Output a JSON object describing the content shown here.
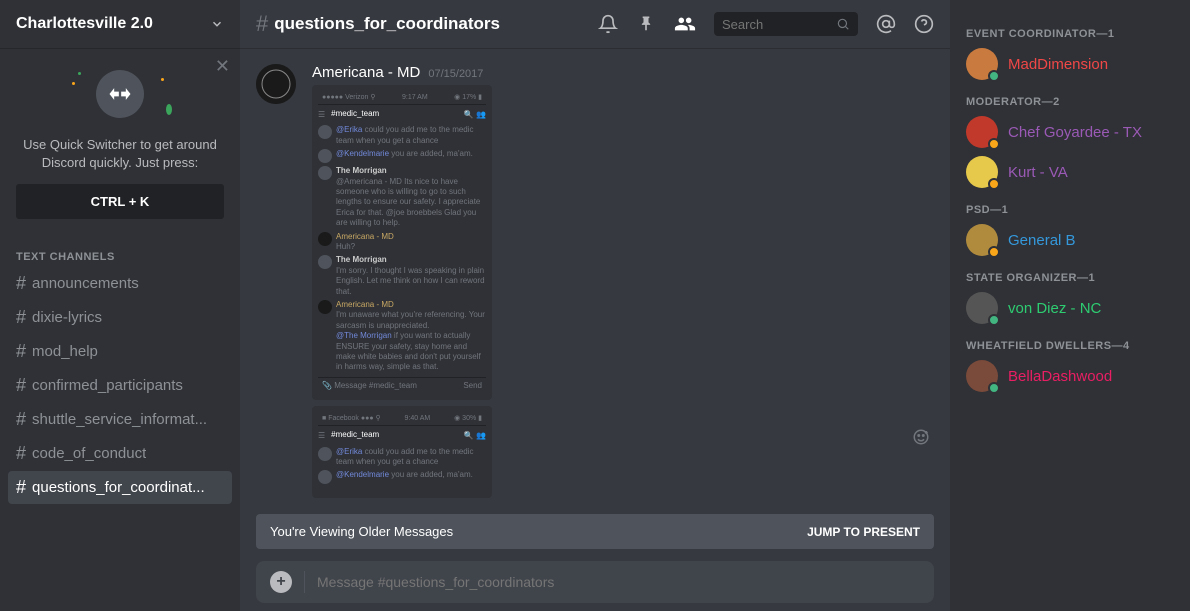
{
  "server": {
    "name": "Charlottesville 2.0"
  },
  "quick_switcher": {
    "text": "Use Quick Switcher to get around Discord quickly. Just press:",
    "button": "CTRL + K"
  },
  "channels": {
    "header": "TEXT CHANNELS",
    "items": [
      {
        "name": "announcements",
        "active": false
      },
      {
        "name": "dixie-lyrics",
        "active": false
      },
      {
        "name": "mod_help",
        "active": false
      },
      {
        "name": "confirmed_participants",
        "active": false
      },
      {
        "name": "shuttle_service_informat...",
        "active": false
      },
      {
        "name": "code_of_conduct",
        "active": false
      },
      {
        "name": "questions_for_coordinat...",
        "active": true
      }
    ]
  },
  "topbar": {
    "channel": "questions_for_coordinators",
    "search_placeholder": "Search"
  },
  "message": {
    "author": "Americana - MD",
    "timestamp": "07/15/2017",
    "att1": {
      "status_left": "Verizon",
      "time": "9:17 AM",
      "battery": "17%",
      "channel": "#medic_team",
      "l1_user": "@Erika",
      "l1_text": " could you add me to the medic team when you get a chance",
      "l2_user": "@Kendelmarie",
      "l2_text": " you are added, ma'am.",
      "l3_user": "The Morrigan",
      "l3_text": "@Americana - MD Its nice to have someone who is willing to go to such lengths to ensure our safety. I appreciate Erica for that. @joe broebbels Glad you are willing to help.",
      "l4_user": "Americana - MD",
      "l4_text": "Huh?",
      "l5_user": "The Morrigan",
      "l5_text": "I'm sorry. I thought I was speaking in plain English. Let me think on how I can reword that.",
      "l6_user": "Americana - MD",
      "l6_text": "I'm unaware what you're referencing. Your sarcasm is unappreciated.",
      "l6_text2_user": "@The Morrigan",
      "l6_text2": " if you want to actually ENSURE your safety, stay home and make white babies and don't put yourself in harms way, simple as that.",
      "input_ph": "Message #medic_team",
      "send": "Send"
    },
    "att2": {
      "status_left": "Facebook",
      "time": "9:40 AM",
      "battery": "30%",
      "channel": "#medic_team",
      "l1_user": "@Erika",
      "l1_text": " could you add me to the medic team when you get a chance",
      "l2_user": "@Kendelmarie",
      "l2_text": " you are added, ma'am."
    }
  },
  "older_bar": {
    "text": "You're Viewing Older Messages",
    "jump": "JUMP TO PRESENT"
  },
  "input": {
    "placeholder": "Message #questions_for_coordinators"
  },
  "members": {
    "roles": [
      {
        "label": "EVENT COORDINATOR—1",
        "color": "#f04747",
        "members": [
          {
            "name": "MadDimension",
            "status": "online",
            "av": "#c97a3e"
          }
        ]
      },
      {
        "label": "MODERATOR—2",
        "color": "#9b59b6",
        "members": [
          {
            "name": "Chef Goyardee - TX",
            "status": "idle",
            "av": "#c0392b"
          },
          {
            "name": "Kurt - VA",
            "status": "idle",
            "av": "#e6c84a"
          }
        ]
      },
      {
        "label": "PSD—1",
        "color": "#3498db",
        "members": [
          {
            "name": "General B",
            "status": "idle",
            "av": "#b08b3e"
          }
        ]
      },
      {
        "label": "STATE ORGANIZER—1",
        "color": "#2ecc71",
        "members": [
          {
            "name": "von Diez - NC",
            "status": "online",
            "av": "#555"
          }
        ]
      },
      {
        "label": "WHEATFIELD DWELLERS—4",
        "color": "#e91e63",
        "members": [
          {
            "name": "BellaDashwood",
            "status": "online",
            "av": "#7a4a3a"
          }
        ]
      }
    ]
  }
}
